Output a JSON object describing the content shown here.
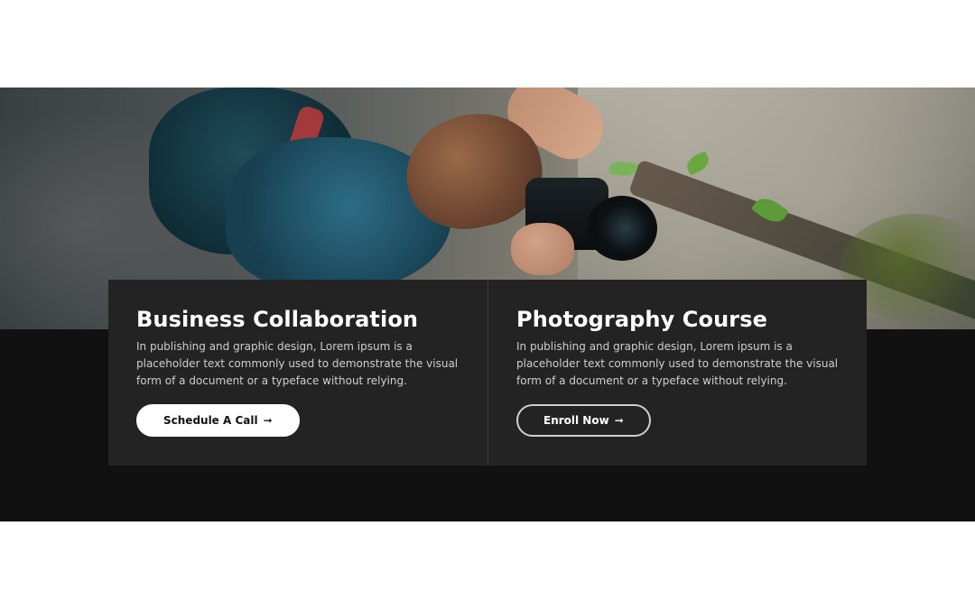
{
  "cards": [
    {
      "title": "Business Collaboration",
      "text": "In publishing and graphic design, Lorem ipsum is a placeholder text commonly used to demonstrate the visual form of a document or a typeface without relying.",
      "button_label": "Schedule A Call"
    },
    {
      "title": "Photography Course",
      "text": "In publishing and graphic design, Lorem ipsum is a placeholder text commonly used to demonstrate the visual form of a document or a typeface without relying.",
      "button_label": "Enroll Now"
    }
  ],
  "icons": {
    "arrow": "➞"
  },
  "colors": {
    "section_bg": "#111111",
    "card_bg": "#232323",
    "text": "#ffffff",
    "muted_text": "#cfcfcf"
  }
}
